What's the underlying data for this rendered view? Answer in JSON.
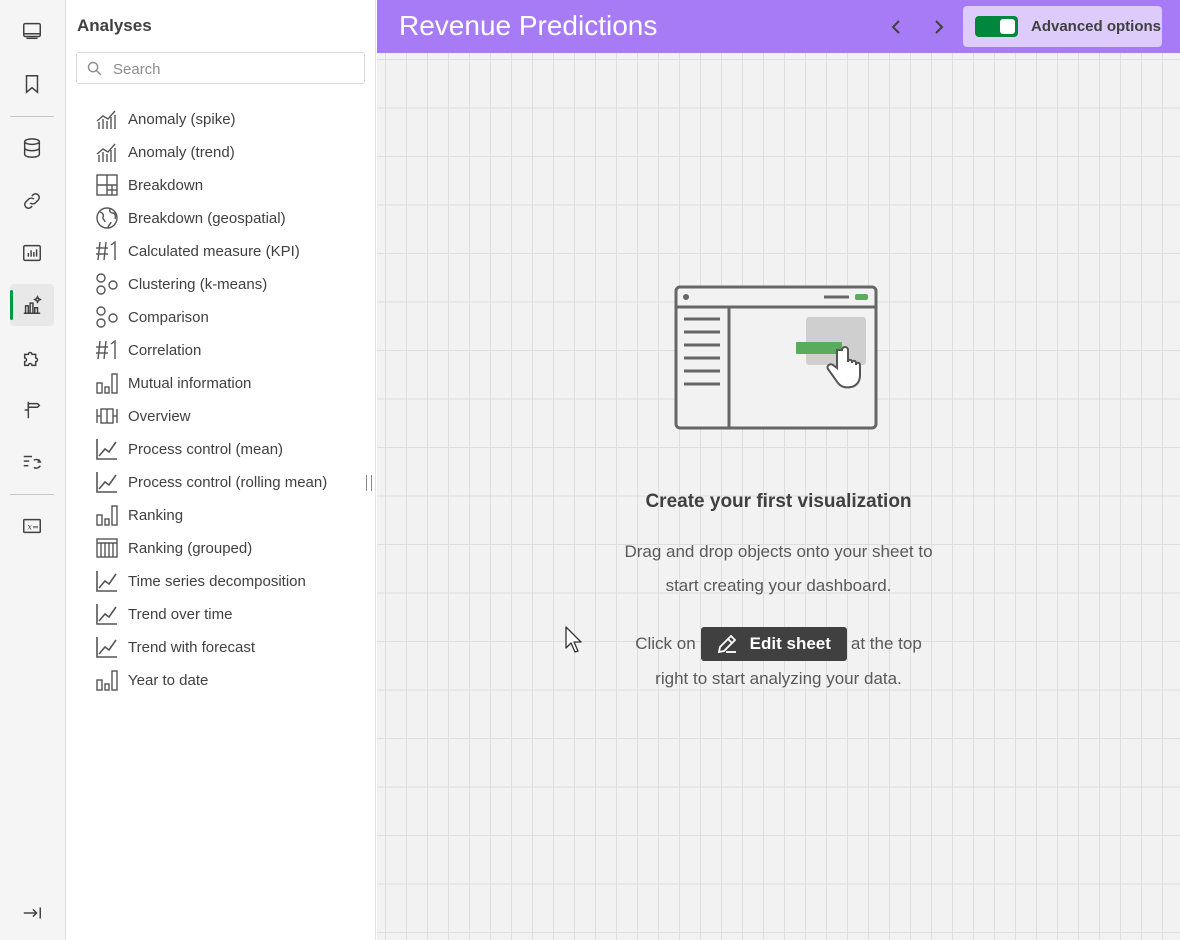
{
  "rail": {
    "items": [
      {
        "icon": "sheets-icon"
      },
      {
        "icon": "bookmark-icon"
      },
      {
        "icon": "database-icon"
      },
      {
        "icon": "link-icon"
      },
      {
        "icon": "chart-icon"
      },
      {
        "icon": "analytics-icon",
        "active": true
      },
      {
        "icon": "puzzle-icon"
      },
      {
        "icon": "signpost-icon"
      },
      {
        "icon": "automation-icon"
      },
      {
        "icon": "variable-icon"
      }
    ],
    "collapse_icon": "collapse-panel-icon"
  },
  "panel": {
    "title": "Analyses",
    "search_placeholder": "Search",
    "items": [
      {
        "label": "Anomaly (spike)",
        "icon": "anomaly-icon"
      },
      {
        "label": "Anomaly (trend)",
        "icon": "anomaly-icon"
      },
      {
        "label": "Breakdown",
        "icon": "breakdown-icon"
      },
      {
        "label": "Breakdown (geospatial)",
        "icon": "globe-icon"
      },
      {
        "label": "Calculated measure (KPI)",
        "icon": "kpi-icon"
      },
      {
        "label": "Clustering (k-means)",
        "icon": "clustering-icon"
      },
      {
        "label": "Comparison",
        "icon": "clustering-icon"
      },
      {
        "label": "Correlation",
        "icon": "kpi-icon"
      },
      {
        "label": "Mutual information",
        "icon": "bar-chart-icon"
      },
      {
        "label": "Overview",
        "icon": "boxplot-icon"
      },
      {
        "label": "Process control (mean)",
        "icon": "line-chart-icon"
      },
      {
        "label": "Process control (rolling mean)",
        "icon": "line-chart-icon"
      },
      {
        "label": "Ranking",
        "icon": "bar-chart-icon"
      },
      {
        "label": "Ranking (grouped)",
        "icon": "table-icon"
      },
      {
        "label": "Time series decomposition",
        "icon": "line-chart-icon"
      },
      {
        "label": "Trend over time",
        "icon": "line-chart-icon"
      },
      {
        "label": "Trend with forecast",
        "icon": "line-chart-icon"
      },
      {
        "label": "Year to date",
        "icon": "bar-chart-icon"
      }
    ]
  },
  "header": {
    "title": "Revenue Predictions",
    "advanced_options_label": "Advanced options",
    "advanced_options_on": true
  },
  "canvas": {
    "empty_title": "Create your first visualization",
    "line1": "Drag and drop objects onto your sheet to",
    "line2": "start creating your dashboard.",
    "click_prefix": "Click on",
    "edit_button_label": "Edit sheet",
    "click_suffix": "at the top",
    "line4": "right to start analyzing your data."
  },
  "colors": {
    "header_bg": "#a87bf6",
    "toggle_on": "#00873d",
    "accent_green": "#009845"
  }
}
